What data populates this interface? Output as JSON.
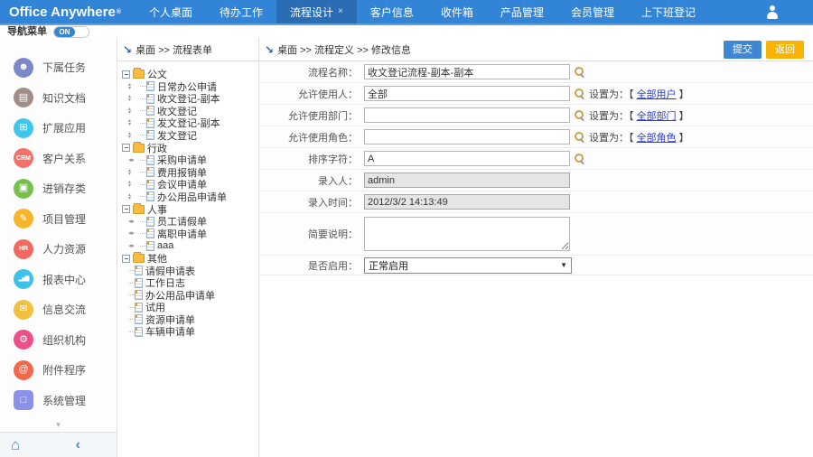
{
  "topbar": {
    "logo": "Office Anywhere",
    "logo_reg": "®",
    "close_glyph": "×",
    "menu": [
      {
        "label": "个人桌面",
        "active": false
      },
      {
        "label": "待办工作",
        "active": false
      },
      {
        "label": "流程设计",
        "active": true
      },
      {
        "label": "客户信息",
        "active": false
      },
      {
        "label": "收件箱",
        "active": false
      },
      {
        "label": "产品管理",
        "active": false
      },
      {
        "label": "会员管理",
        "active": false
      },
      {
        "label": "上下班登记",
        "active": false
      }
    ]
  },
  "navbar": {
    "label": "导航菜单",
    "toggle_state": "ON"
  },
  "sidebar": {
    "items": [
      {
        "name": "subordinate-tasks",
        "label": "下属任务",
        "color": "#7d88cb",
        "glyph": "☻",
        "icon": "people-icon",
        "style": "glyph"
      },
      {
        "name": "knowledge-docs",
        "label": "知识文档",
        "color": "#a08d86",
        "glyph": "▤",
        "icon": "book-icon",
        "style": "glyph"
      },
      {
        "name": "extended-apps",
        "label": "扩展应用",
        "color": "#41c5e8",
        "glyph": "⊞",
        "icon": "apps-icon",
        "style": "glyph"
      },
      {
        "name": "customer-relations",
        "label": "客户关系",
        "color": "#f3726a",
        "glyph": "CRM",
        "icon": "crm-icon",
        "style": "txt"
      },
      {
        "name": "inventory",
        "label": "进销存类",
        "color": "#76c14c",
        "glyph": "▣",
        "icon": "box-icon",
        "style": "glyph"
      },
      {
        "name": "project-mgmt",
        "label": "项目管理",
        "color": "#f7b52c",
        "glyph": "✎",
        "icon": "document-pencil-icon",
        "style": "glyph"
      },
      {
        "name": "human-resources",
        "label": "人力资源",
        "color": "#f3695f",
        "glyph": "HR",
        "icon": "hr-icon",
        "style": "txt"
      },
      {
        "name": "report-center",
        "label": "报表中心",
        "color": "#3ec1e8",
        "glyph": "▂▅▇",
        "icon": "bar-chart-icon",
        "style": "bars"
      },
      {
        "name": "messaging",
        "label": "信息交流",
        "color": "#f1c040",
        "glyph": "✉",
        "icon": "chat-icon",
        "style": "glyph"
      },
      {
        "name": "organization",
        "label": "组织机构",
        "color": "#ed4f8a",
        "glyph": "⚙",
        "icon": "gear-icon",
        "style": "glyph"
      },
      {
        "name": "attachments",
        "label": "附件程序",
        "color": "#f2684a",
        "glyph": "@",
        "icon": "paperclip-icon",
        "style": "glyph"
      },
      {
        "name": "system-mgmt",
        "label": "系统管理",
        "color": "#8b90e8",
        "glyph": "□",
        "icon": "system-icon",
        "style": "glyph",
        "shape": "square"
      }
    ],
    "collapse_glyph": "▾",
    "footer": {
      "home_glyph": "⌂",
      "back_glyph": "‹"
    }
  },
  "tree": {
    "breadcrumb": "桌面 >> 流程表单",
    "arrow_glyph": "↘",
    "handle_glyphs": {
      "ud": [
        "▴",
        "▾"
      ],
      "lr": [
        "◂",
        "▸"
      ]
    },
    "folders": [
      {
        "name": "公文",
        "children": [
          {
            "label": "日常办公申请",
            "handle": "ud"
          },
          {
            "label": "收文登记-副本",
            "handle": "ud"
          },
          {
            "label": "收文登记",
            "handle": "ud"
          },
          {
            "label": "发文登记-副本",
            "handle": "ud"
          },
          {
            "label": "发文登记",
            "handle": "ud"
          }
        ]
      },
      {
        "name": "行政",
        "children": [
          {
            "label": "采购申请单",
            "handle": "lr"
          },
          {
            "label": "费用报销单",
            "handle": "ud"
          },
          {
            "label": "会议申请单",
            "handle": "ud"
          },
          {
            "label": "办公用品申请单",
            "handle": "ud"
          }
        ]
      },
      {
        "name": "人事",
        "children": [
          {
            "label": "员工请假单",
            "handle": "lr"
          },
          {
            "label": "离职申请单",
            "handle": "lr"
          },
          {
            "label": "aaa",
            "handle": "lr"
          }
        ]
      },
      {
        "name": "其他",
        "children": [
          {
            "label": "请假申请表",
            "handle": ""
          },
          {
            "label": "工作日志",
            "handle": ""
          },
          {
            "label": "办公用品申请单",
            "handle": ""
          },
          {
            "label": "试用",
            "handle": ""
          },
          {
            "label": "资源申请单",
            "handle": ""
          },
          {
            "label": "车辆申请单",
            "handle": ""
          }
        ]
      }
    ]
  },
  "form": {
    "breadcrumb": "桌面 >> 流程定义 >> 修改信息",
    "arrow_glyph": "↘",
    "submit_label": "提交",
    "back_label": "返回",
    "select_caret": "▼",
    "rows": [
      {
        "name": "flow-name",
        "label": "流程名称：",
        "type": "text",
        "value": "收文登记流程-副本-副本",
        "magnifier": true
      },
      {
        "name": "allowed-users",
        "label": "允许使用人：",
        "type": "text",
        "value": "全部",
        "magnifier": true,
        "set_prefix": "设置为：【 ",
        "link": "全部用户",
        "set_suffix": " 】"
      },
      {
        "name": "allowed-depts",
        "label": "允许使用部门：",
        "type": "text",
        "value": "",
        "magnifier": true,
        "set_prefix": "设置为：【 ",
        "link": "全部部门",
        "set_suffix": " 】"
      },
      {
        "name": "allowed-roles",
        "label": "允许使用角色：",
        "type": "text",
        "value": "",
        "magnifier": true,
        "set_prefix": "设置为：【 ",
        "link": "全部角色",
        "set_suffix": " 】"
      },
      {
        "name": "sort-char",
        "label": "排序字符：",
        "type": "text",
        "value": "A",
        "magnifier": true
      },
      {
        "name": "creator",
        "label": "录入人：",
        "type": "text",
        "value": "admin",
        "readonly": true
      },
      {
        "name": "create-time",
        "label": "录入时间：",
        "type": "text",
        "value": "2012/3/2 14:13:49",
        "readonly": true
      },
      {
        "name": "description",
        "label": "简要说明：",
        "type": "textarea",
        "value": ""
      },
      {
        "name": "enabled",
        "label": "是否启用：",
        "type": "select",
        "value": "正常启用"
      }
    ]
  }
}
